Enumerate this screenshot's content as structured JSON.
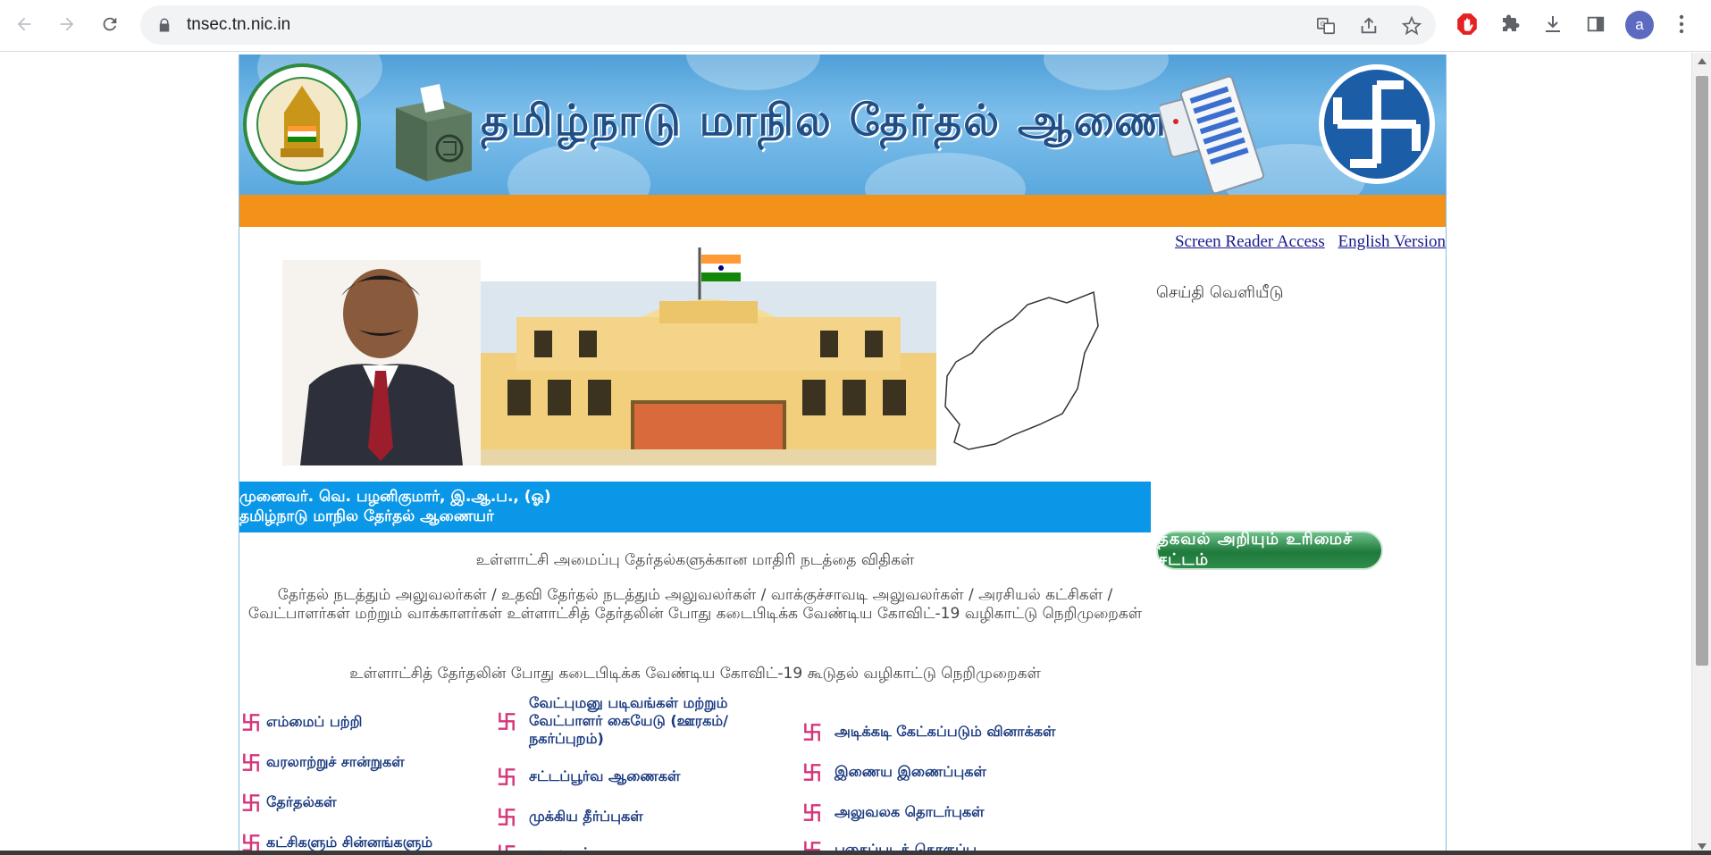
{
  "browser": {
    "url": "tnsec.tn.nic.in",
    "profile_initial": "a"
  },
  "header": {
    "site_title": "தமிழ்நாடு மாநில தேர்தல் ஆணையம்"
  },
  "top_links": {
    "screen_reader": "Screen Reader Access",
    "english": "English Version"
  },
  "sidebar": {
    "news_heading": "செய்தி வெளியீடு",
    "rti_label": "தகவல் அறியும் உரிமைச் சட்டம்"
  },
  "commissioner": {
    "name": "முனைவர். வெ. பழனிகுமார், இ.ஆ.ப., (ஓ)",
    "designation": "தமிழ்நாடு மாநில தேர்தல் ஆணையர்"
  },
  "notices": {
    "model_code": "உள்ளாட்சி அமைப்பு தேர்தல்களுக்கான மாதிரி நடத்தை விதிகள்",
    "covid_guidelines": "தேர்தல் நடத்தும் அலுவலர்கள் / உதவி தேர்தல் நடத்தும் அலுவலர்கள் / வாக்குச்சாவடி அலுவலர்கள் / அரசியல் கட்சிகள் / வேட்பாளர்கள் மற்றும் வாக்காளர்கள் உள்ளாட்சித் தேர்தலின் போது கடைபிடிக்க வேண்டிய கோவிட்-19 வழிகாட்டு நெறிமுறைகள்",
    "covid_additional": "உள்ளாட்சித் தேர்தலின் போது கடைபிடிக்க வேண்டிய கோவிட்-19 கூடுதல் வழிகாட்டு நெறிமுறைகள்"
  },
  "links": {
    "col1": [
      "எம்மைப் பற்றி",
      "வரலாற்றுச் சான்றுகள்",
      "தேர்தல்கள்",
      "கட்சிகளும் சின்னங்களும்"
    ],
    "col2": [
      "வேட்புமனு படிவங்கள் மற்றும் வேட்பாளர் கையேடு (ஊரகம்/ நகர்ப்புறம்)",
      "சட்டப்பூர்வ ஆணைகள்",
      "முக்கிய தீர்ப்புகள்",
      "முடிவுகள்"
    ],
    "col3": [
      "அடிக்கடி கேட்கப்படும் வினாக்கள்",
      "இணைய இணைப்புகள்",
      "அலுவலக தொடர்புகள்",
      "புகைப்படத் தொகுப்பு"
    ]
  },
  "colors": {
    "banner_blue": "#5aa8de",
    "orange": "#f29218",
    "strip_blue": "#0a97e8",
    "link_blue": "#1a3a80",
    "symbol_pink": "#d6357a"
  }
}
